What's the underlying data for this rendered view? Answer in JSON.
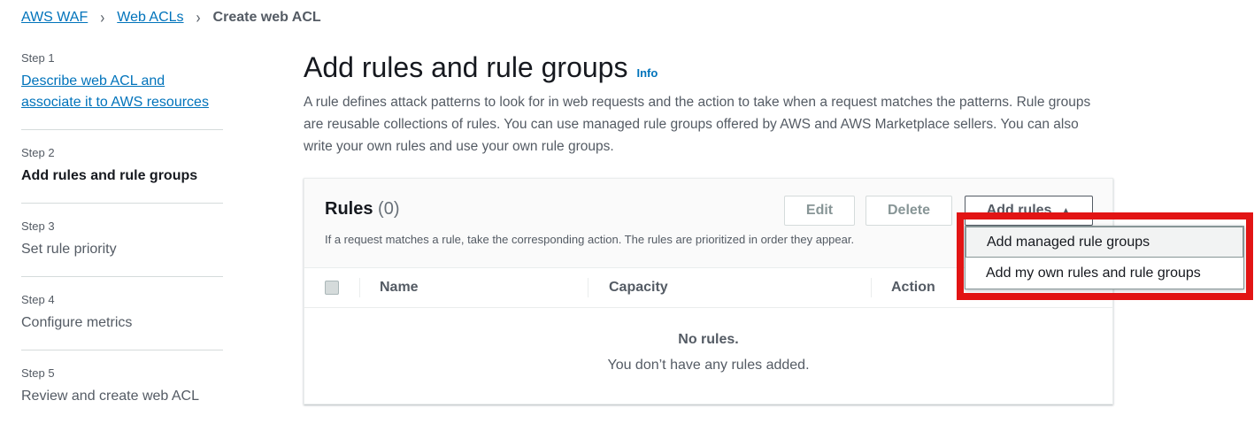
{
  "breadcrumb": {
    "items": [
      "AWS WAF",
      "Web ACLs"
    ],
    "current": "Create web ACL",
    "separator": "›"
  },
  "sidebar": {
    "steps": [
      {
        "number": "Step 1",
        "label": "Describe web ACL and associate it to AWS resources",
        "state": "link"
      },
      {
        "number": "Step 2",
        "label": "Add rules and rule groups",
        "state": "active"
      },
      {
        "number": "Step 3",
        "label": "Set rule priority",
        "state": "pending"
      },
      {
        "number": "Step 4",
        "label": "Configure metrics",
        "state": "pending"
      },
      {
        "number": "Step 5",
        "label": "Review and create web ACL",
        "state": "pending"
      }
    ]
  },
  "main": {
    "title": "Add rules and rule groups",
    "info": "Info",
    "description": "A rule defines attack patterns to look for in web requests and the action to take when a request matches the patterns. Rule groups are reusable collections of rules. You can use managed rule groups offered by AWS and AWS Marketplace sellers. You can also write your own rules and use your own rule groups."
  },
  "rules_panel": {
    "title": "Rules",
    "count": "(0)",
    "subtitle": "If a request matches a rule, take the corresponding action. The rules are prioritized in order they appear.",
    "edit_label": "Edit",
    "delete_label": "Delete",
    "add_label": "Add rules",
    "columns": [
      "Name",
      "Capacity",
      "Action"
    ],
    "empty_title": "No rules.",
    "empty_text": "You don’t have any rules added."
  },
  "dropdown": {
    "items": [
      "Add managed rule groups",
      "Add my own rules and rule groups"
    ]
  },
  "colors": {
    "link": "#0073bb",
    "highlight": "#e21414",
    "text": "#16191f",
    "muted": "#545b64"
  }
}
